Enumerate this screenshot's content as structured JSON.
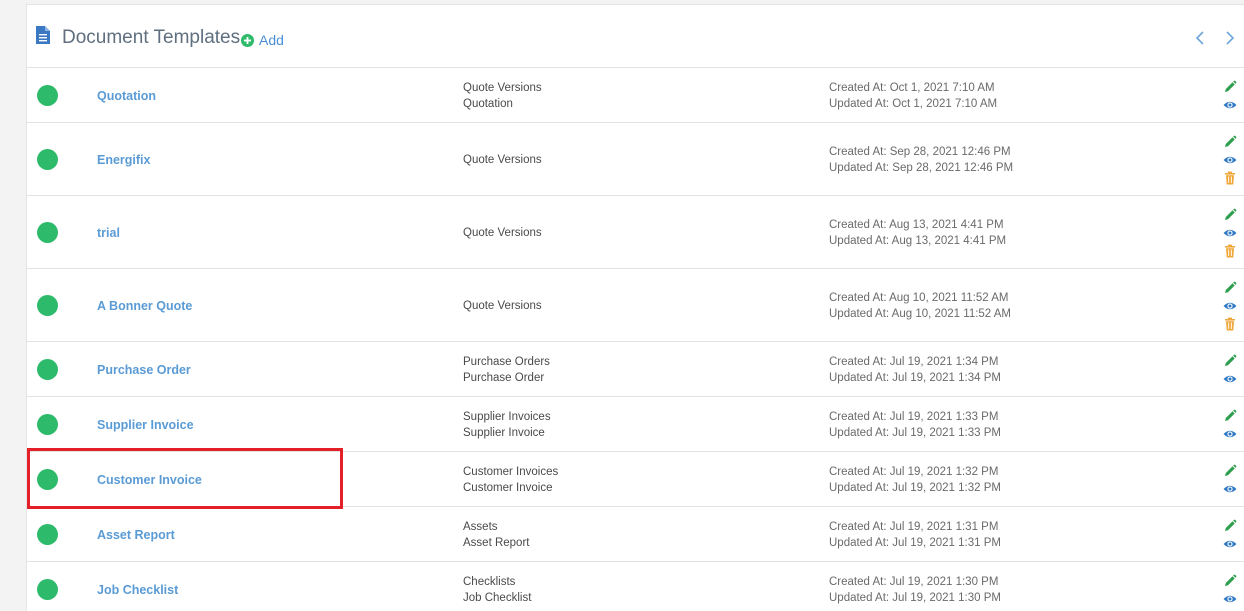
{
  "header": {
    "title": "Document Templates",
    "add_label": "Add",
    "doc_icon": "document-icon",
    "prev_icon": "chevron-left-icon",
    "next_icon": "chevron-right-icon"
  },
  "colors": {
    "status_green": "#2dba6b",
    "link_blue": "#5a9bd5",
    "edit_green": "#2e9e4f",
    "view_blue": "#2f78c4",
    "delete_orange": "#f0a73a",
    "highlight_red": "#e32027"
  },
  "rows": [
    {
      "name": "Quotation",
      "cat1": "Quote Versions",
      "cat2": "Quotation",
      "created": "Created At: Oct 1, 2021 7:10 AM",
      "updated": "Updated At: Oct 1, 2021 7:10 AM",
      "deletable": false
    },
    {
      "name": "Energifix",
      "cat1": "Quote Versions",
      "cat2": "",
      "created": "Created At: Sep 28, 2021 12:46 PM",
      "updated": "Updated At: Sep 28, 2021 12:46 PM",
      "deletable": true
    },
    {
      "name": "trial",
      "cat1": "Quote Versions",
      "cat2": "",
      "created": "Created At: Aug 13, 2021 4:41 PM",
      "updated": "Updated At: Aug 13, 2021 4:41 PM",
      "deletable": true
    },
    {
      "name": "A Bonner Quote",
      "cat1": "Quote Versions",
      "cat2": "",
      "created": "Created At: Aug 10, 2021 11:52 AM",
      "updated": "Updated At: Aug 10, 2021 11:52 AM",
      "deletable": true
    },
    {
      "name": "Purchase Order",
      "cat1": "Purchase Orders",
      "cat2": "Purchase Order",
      "created": "Created At: Jul 19, 2021 1:34 PM",
      "updated": "Updated At: Jul 19, 2021 1:34 PM",
      "deletable": false
    },
    {
      "name": "Supplier Invoice",
      "cat1": "Supplier Invoices",
      "cat2": "Supplier Invoice",
      "created": "Created At: Jul 19, 2021 1:33 PM",
      "updated": "Updated At: Jul 19, 2021 1:33 PM",
      "deletable": false
    },
    {
      "name": "Customer Invoice",
      "cat1": "Customer Invoices",
      "cat2": "Customer Invoice",
      "created": "Created At: Jul 19, 2021 1:32 PM",
      "updated": "Updated At: Jul 19, 2021 1:32 PM",
      "deletable": false
    },
    {
      "name": "Asset Report",
      "cat1": "Assets",
      "cat2": "Asset Report",
      "created": "Created At: Jul 19, 2021 1:31 PM",
      "updated": "Updated At: Jul 19, 2021 1:31 PM",
      "deletable": false
    },
    {
      "name": "Job Checklist",
      "cat1": "Checklists",
      "cat2": "Job Checklist",
      "created": "Created At: Jul 19, 2021 1:30 PM",
      "updated": "Updated At: Jul 19, 2021 1:30 PM",
      "deletable": false
    }
  ]
}
